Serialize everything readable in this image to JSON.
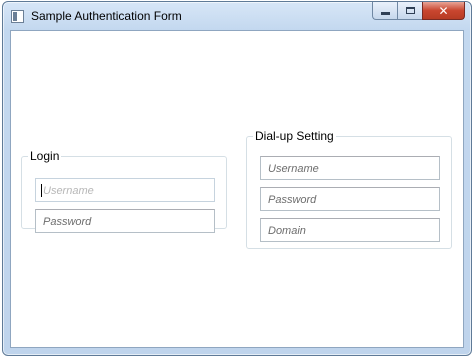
{
  "window": {
    "title": "Sample Authentication Form"
  },
  "caption_buttons": {
    "minimize": "minimize-icon",
    "maximize": "maximize-icon",
    "close": "close-icon"
  },
  "login": {
    "legend": "Login",
    "username": {
      "placeholder": "Username",
      "value": ""
    },
    "password": {
      "placeholder": "Password",
      "value": ""
    }
  },
  "dialup": {
    "legend": "Dial-up Setting",
    "username": {
      "placeholder": "Username",
      "value": ""
    },
    "password": {
      "placeholder": "Password",
      "value": ""
    },
    "domain": {
      "placeholder": "Domain",
      "value": ""
    }
  }
}
